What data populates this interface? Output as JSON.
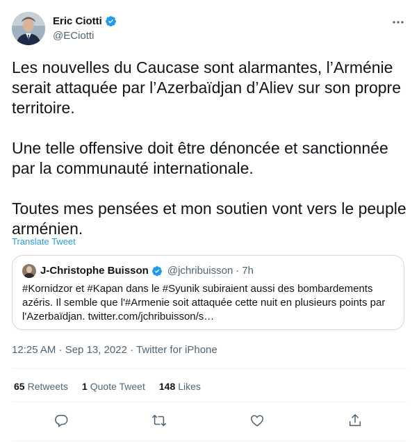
{
  "author": {
    "name": "Eric Ciotti",
    "handle": "@ECiotti",
    "avatar_icon": "profile-photo-icon",
    "verified_icon": "verified-badge-icon"
  },
  "tweet": {
    "text": "Les nouvelles du Caucase sont alarmantes, l’Arménie serait attaquée par l’Azerbaïdjan d’Aliev sur son propre territoire.\n\nUne telle offensive doit être dénoncée et sanctionnée par la communauté internationale.\n\nToutes mes pensées et mon soutien vont vers le peuple arménien.",
    "translate_label": "Translate Tweet"
  },
  "quote": {
    "name": "J-Christophe Buisson",
    "handle": "@jchribuisson",
    "separator": "·",
    "time": "7h",
    "text": "#Kornidzor et #Kapan dans le #Syunik subiraient aussi des bombardements azéris. Il semble que l'#Armenie soit attaquée cette nuit en plusieurs points par l'Azerbaïdjan. twitter.com/jchribuisson/s…"
  },
  "meta": {
    "line": "12:25 AM · Sep 13, 2022 · Twitter for iPhone"
  },
  "stats": {
    "retweets_count": "65",
    "retweets_label": "Retweets",
    "quotes_count": "1",
    "quotes_label": "Quote Tweet",
    "likes_count": "148",
    "likes_label": "Likes"
  },
  "actions": [
    "reply-icon",
    "retweet-icon",
    "like-icon",
    "share-icon"
  ],
  "colors": {
    "accent": "#1d9bf0",
    "text": "#0f1419",
    "secondary": "#536471",
    "border": "#cfd9de"
  }
}
